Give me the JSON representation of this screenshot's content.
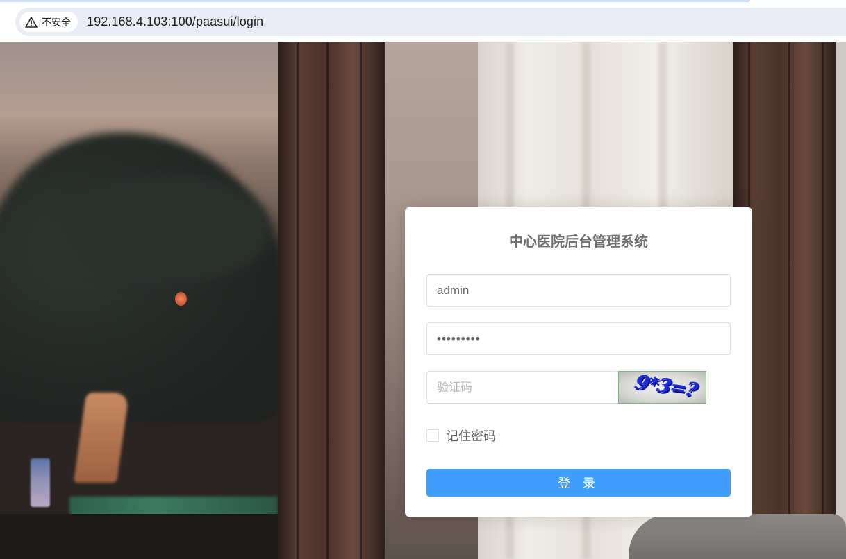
{
  "browser": {
    "security_label": "不安全",
    "url": "192.168.4.103:100/paasui/login"
  },
  "login": {
    "title": "中心医院后台管理系统",
    "username_value": "admin",
    "password_value": "•••••••••",
    "captcha_placeholder": "验证码",
    "captcha_text": "9*3=?",
    "remember_label": "记住密码",
    "remember_checked": false,
    "submit_label": "登 录"
  },
  "colors": {
    "primary_button": "#409eff",
    "title_text": "#707070",
    "captcha_ink": "#1e2bd0"
  }
}
